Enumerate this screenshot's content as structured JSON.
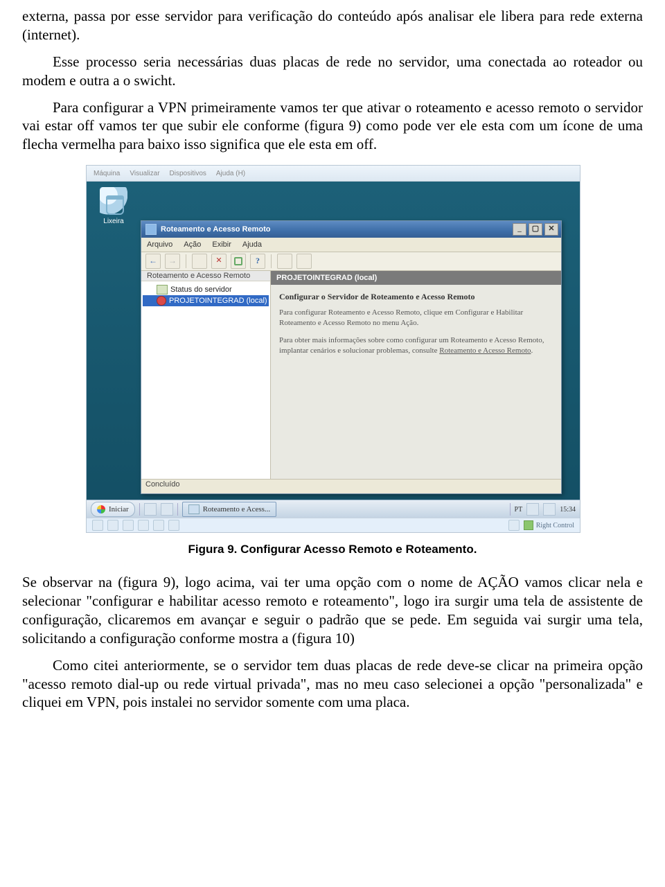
{
  "para1": "externa, passa por esse servidor para verificação do conteúdo após analisar ele libera para rede externa (internet).",
  "para2": "Esse processo seria necessárias duas placas de rede no servidor, uma conectada ao roteador ou modem e outra a o swicht.",
  "para3": "Para configurar a VPN primeiramente vamos ter que ativar o roteamento e acesso remoto o servidor vai estar off vamos ter que subir ele conforme (figura 9) como pode ver ele esta com um ícone de uma flecha vermelha para baixo isso significa que ele esta em off.",
  "caption": "Figura 9. Configurar Acesso Remoto e Roteamento.",
  "para4": "Se observar na (figura 9), logo acima, vai ter uma opção com o nome de AÇÃO vamos clicar nela e selecionar \"configurar e habilitar acesso remoto e roteamento\", logo ira surgir uma tela de assistente de configuração, clicaremos em avançar e seguir o padrão que se pede. Em seguida vai surgir uma tela, solicitando a configuração conforme mostra a (figura 10)",
  "para5": "Como citei anteriormente, se o servidor tem duas placas de rede deve-se clicar na primeira opção \"acesso remoto dial-up ou rede virtual privada\", mas no meu caso selecionei a opção \"personalizada\" e cliquei em VPN, pois instalei no servidor somente com uma placa.",
  "vm": {
    "menubar": [
      "Máquina",
      "Visualizar",
      "Dispositivos",
      "Ajuda (H)"
    ],
    "recycle_label": "Lixeira",
    "statusbar_host": "Right Control"
  },
  "mmc": {
    "title": "Roteamento e Acesso Remoto",
    "menus": [
      "Arquivo",
      "Ação",
      "Exibir",
      "Ajuda"
    ],
    "tree_head": "Roteamento e Acesso Remoto",
    "tree_status": "Status do servidor",
    "tree_server": "PROJETOINTEGRAD (local)",
    "content_head": "PROJETOINTEGRAD (local)",
    "content_title": "Configurar o Servidor de Roteamento e Acesso Remoto",
    "content_p1": "Para configurar Roteamento e Acesso Remoto, clique em Configurar e Habilitar Roteamento e Acesso Remoto no menu Ação.",
    "content_p2a": "Para obter mais informações sobre como configurar um Roteamento e Acesso Remoto, implantar cenários e solucionar problemas, consulte ",
    "content_p2b": "Roteamento e Acesso Remoto",
    "content_p2c": ".",
    "statusbar": "Concluído"
  },
  "taskbar": {
    "start": "Iniciar",
    "task": "Roteamento e Acess...",
    "lang": "PT",
    "time": "15:34"
  }
}
